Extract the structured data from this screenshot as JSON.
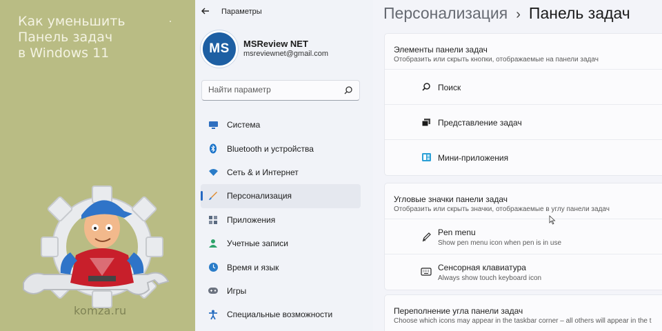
{
  "banner": {
    "title_lines": [
      "Как уменьшить",
      "Панель задач",
      "в Windows 11"
    ],
    "site": "komza.ru"
  },
  "window": {
    "app_title": "Параметры",
    "user": {
      "initials": "MS",
      "name": "MSReview NET",
      "email": "msreviewnet@gmail.com"
    },
    "search": {
      "placeholder": "Найти параметр",
      "value": ""
    },
    "nav": [
      {
        "label": "Система",
        "icon": "monitor-icon",
        "color": "#2f6fc0"
      },
      {
        "label": "Bluetooth и устройства",
        "icon": "bluetooth-icon",
        "color": "#1a73c9"
      },
      {
        "label": "Сеть & и Интернет",
        "icon": "wifi-icon",
        "color": "#2a7cc8"
      },
      {
        "label": "Персонализация",
        "icon": "brush-icon",
        "color": "#e08a2c",
        "active": true
      },
      {
        "label": "Приложения",
        "icon": "apps-icon",
        "color": "#5a6a80"
      },
      {
        "label": "Учетные записи",
        "icon": "person-icon",
        "color": "#2fa36b"
      },
      {
        "label": "Время и язык",
        "icon": "clock-globe-icon",
        "color": "#2a7cc8"
      },
      {
        "label": "Игры",
        "icon": "gamepad-icon",
        "color": "#6c7380"
      },
      {
        "label": "Специальные возможности",
        "icon": "accessibility-icon",
        "color": "#2a6fc0"
      }
    ]
  },
  "content": {
    "breadcrumb": {
      "parent": "Персонализация",
      "separator": "›",
      "current": "Панель задач"
    },
    "sections": {
      "elements": {
        "title": "Элементы панели задач",
        "subtitle": "Отобразить или скрыть кнопки, отображаемые на панели задач",
        "rows": [
          {
            "label": "Поиск",
            "icon": "search-icon"
          },
          {
            "label": "Представление задач",
            "icon": "task-view-icon"
          },
          {
            "label": "Мини-приложения",
            "icon": "widgets-icon"
          }
        ]
      },
      "corner": {
        "title": "Угловые значки панели задач",
        "subtitle": "Отобразить или скрыть значки, отображаемые в углу панели задач",
        "rows": [
          {
            "label": "Pen menu",
            "sub": "Show pen menu icon when pen is in use",
            "icon": "pen-icon"
          },
          {
            "label": "Сенсорная клавиатура",
            "sub": "Always show touch keyboard icon",
            "icon": "keyboard-icon"
          }
        ]
      },
      "overflow": {
        "title": "Переполнение угла панели задач",
        "subtitle": "Choose which icons may appear in the taskbar corner – all others will appear in the t"
      }
    }
  },
  "colors": {
    "banner_bg": "#b9bc84",
    "accent": "#2468c2",
    "avatar_bg": "#1d5fa3"
  }
}
